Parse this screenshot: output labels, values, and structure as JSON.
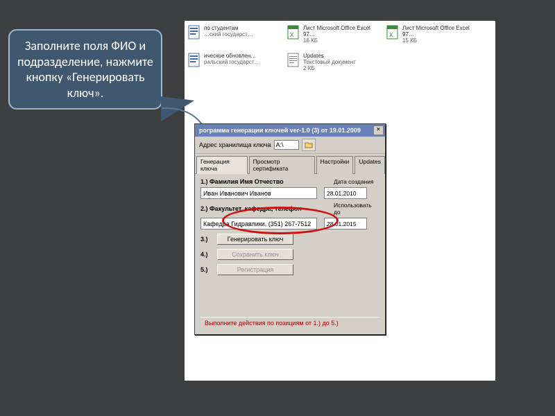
{
  "callout": {
    "text": "Заполните поля ФИО и подразделение, нажмите кнопку «Генерировать ключ»."
  },
  "files": [
    {
      "name": "по студентам",
      "desc1": "…ский государст…",
      "desc2": "",
      "type": "doc"
    },
    {
      "name": "Лист Microsoft Office Excel 97…",
      "desc1": "16 КБ",
      "desc2": "",
      "type": "xls"
    },
    {
      "name": "Лист Microsoft Office Excel 97…",
      "desc1": "15 КБ",
      "desc2": "",
      "type": "xls"
    },
    {
      "name": "ическое обновлен…",
      "desc1": "ральский государст…",
      "desc2": "",
      "type": "doc"
    },
    {
      "name": "Updates",
      "desc1": "Текстовый документ",
      "desc2": "2 КБ",
      "type": "txt"
    }
  ],
  "dialog": {
    "title": "рограмма генерации ключей  ver-1.0 (3) от 19.01.2009",
    "close": "×",
    "addr_label": "Адрес хранилища ключа",
    "addr_value": "A:\\",
    "tabs": [
      "Генерация ключа",
      "Просмотр сертификата",
      "Настройки",
      "Updates"
    ],
    "field1_label": "1.) Фамилия Имя Отчество",
    "field1_value": "Иван Иванович Иванов",
    "date_created_label": "Дата создания",
    "date_created_value": "28.01.2010",
    "field2_label": "2.) Факультет, кафедра, телефон",
    "field2_value": "Кафедра Гидравлики, (351) 267-7512",
    "date_until_label": "Использовать до",
    "date_until_value": "28.01.2015",
    "step3_label": "3.)",
    "step3_btn": "Генерировать ключ",
    "step4_label": "4.)",
    "step4_btn": "Сохранить ключ",
    "step5_label": "5.)",
    "step5_btn": "Регистрация",
    "status": "Выполните действия по позициям от 1.) до 5.)"
  }
}
